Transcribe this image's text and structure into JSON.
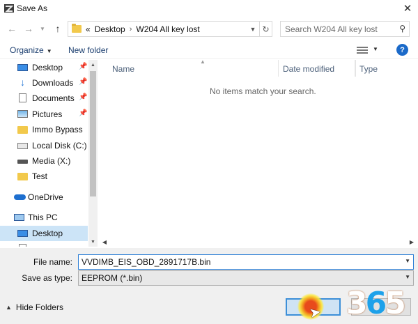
{
  "window": {
    "title": "Save As",
    "close_label": "✕"
  },
  "nav": {
    "back_icon": "arrow-left-icon",
    "forward_icon": "arrow-right-icon",
    "up_icon": "arrow-up-icon",
    "breadcrumb": {
      "overflow": "«",
      "segments": [
        "Desktop",
        "W204 All key lost"
      ]
    },
    "search_placeholder": "Search W204 All key lost"
  },
  "toolbar": {
    "organize_label": "Organize",
    "new_folder_label": "New folder",
    "help_label": "?"
  },
  "sidebar": {
    "items": [
      {
        "label": "Desktop",
        "icon": "desktop-icon",
        "pinned": true
      },
      {
        "label": "Downloads",
        "icon": "download-icon",
        "pinned": true
      },
      {
        "label": "Documents",
        "icon": "documents-icon",
        "pinned": true
      },
      {
        "label": "Pictures",
        "icon": "pictures-icon",
        "pinned": true
      },
      {
        "label": "Immo Bypass",
        "icon": "folder-icon",
        "pinned": false
      },
      {
        "label": "Local Disk (C:)",
        "icon": "disk-icon",
        "pinned": false
      },
      {
        "label": "Media (X:)",
        "icon": "drive-icon",
        "pinned": false
      },
      {
        "label": "Test",
        "icon": "folder-icon",
        "pinned": false
      },
      {
        "label": "OneDrive",
        "icon": "cloud-icon",
        "pinned": false
      },
      {
        "label": "This PC",
        "icon": "computer-icon",
        "pinned": false
      },
      {
        "label": "Desktop",
        "icon": "desktop-icon",
        "pinned": false,
        "selected": true
      }
    ]
  },
  "file_list": {
    "columns": [
      "Name",
      "Date modified",
      "Type"
    ],
    "empty_message": "No items match your search."
  },
  "form": {
    "file_name_label": "File name:",
    "file_name_value": "VVDIMB_EIS_OBD_2891717B.bin",
    "save_type_label": "Save as type:",
    "save_type_value": "EEPROM (*.bin)"
  },
  "footer": {
    "hide_folders_label": "Hide Folders"
  },
  "watermark": {
    "text_a": "3",
    "text_b": "6",
    "text_c": "5"
  },
  "colors": {
    "accent": "#1b6ac9",
    "selection": "#cce4f7",
    "link": "#1a3d6e"
  }
}
